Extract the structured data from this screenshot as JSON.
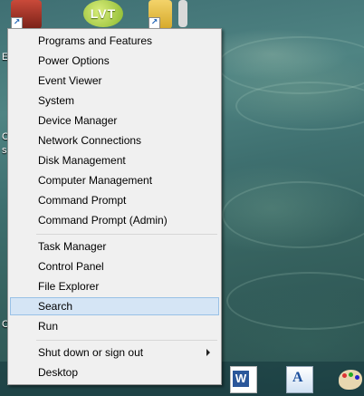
{
  "desktop": {
    "shortcuts": [
      {
        "name": "app-shortcut-1",
        "icon": "toolbox-icon"
      },
      {
        "name": "lvt-shortcut",
        "icon": "lvt-logo-icon",
        "logo_text": "LVT"
      },
      {
        "name": "folder-shortcut",
        "icon": "cabinet-icon"
      }
    ],
    "edge_letters": [
      "E",
      "C",
      "s",
      "C"
    ]
  },
  "context_menu": {
    "items": [
      {
        "label": "Programs and Features"
      },
      {
        "label": "Power Options"
      },
      {
        "label": "Event Viewer"
      },
      {
        "label": "System"
      },
      {
        "label": "Device Manager"
      },
      {
        "label": "Network Connections"
      },
      {
        "label": "Disk Management"
      },
      {
        "label": "Computer Management"
      },
      {
        "label": "Command Prompt"
      },
      {
        "label": "Command Prompt (Admin)"
      },
      {
        "label": "Task Manager"
      },
      {
        "label": "Control Panel"
      },
      {
        "label": "File Explorer"
      },
      {
        "label": "Search",
        "highlighted": true
      },
      {
        "label": "Run"
      },
      {
        "label": "Shut down or sign out",
        "has_submenu": true
      },
      {
        "label": "Desktop"
      }
    ]
  },
  "taskbar": {
    "icons": [
      {
        "name": "word-icon",
        "text": "W"
      },
      {
        "name": "wordpad-icon",
        "text": "A"
      },
      {
        "name": "paint-icon"
      }
    ]
  },
  "colors": {
    "menu_bg": "#f0f0f0",
    "highlight_bg": "#d5e5f5",
    "highlight_border": "#99c1e6",
    "word_blue": "#2b579a"
  }
}
